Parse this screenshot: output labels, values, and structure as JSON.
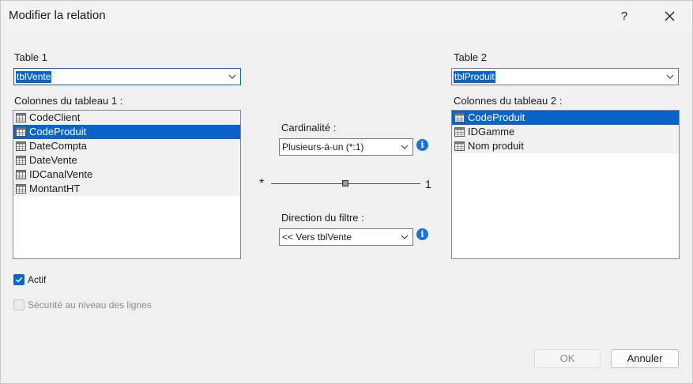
{
  "window": {
    "title": "Modifier la relation",
    "help_label": "?"
  },
  "table1": {
    "label": "Table 1",
    "selected": "tblVente",
    "columns_label": "Colonnes du tableau 1 :",
    "columns": [
      "CodeClient",
      "CodeProduit",
      "DateCompta",
      "DateVente",
      "IDCanalVente",
      "MontantHT"
    ],
    "selected_column": "CodeProduit"
  },
  "table2": {
    "label": "Table 2",
    "selected": "tblProduit",
    "columns_label": "Colonnes du tableau 2 :",
    "columns": [
      "CodeProduit",
      "IDGamme",
      "Nom produit"
    ],
    "selected_column": "CodeProduit"
  },
  "cardinality": {
    "label": "Cardinalité :",
    "value": "Plusieurs-à-un (*:1)",
    "left_symbol": "*",
    "right_symbol": "1"
  },
  "filter_direction": {
    "label": "Direction du filtre :",
    "value": "<< Vers tblVente"
  },
  "options": {
    "active_label": "Actif",
    "active_checked": true,
    "rls_label": "Sécurité au niveau des lignes",
    "rls_checked": false
  },
  "buttons": {
    "ok": "OK",
    "cancel": "Annuler"
  },
  "colors": {
    "accent": "#0a64c8",
    "info": "#1a73d9",
    "background": "#f0f0f0"
  }
}
